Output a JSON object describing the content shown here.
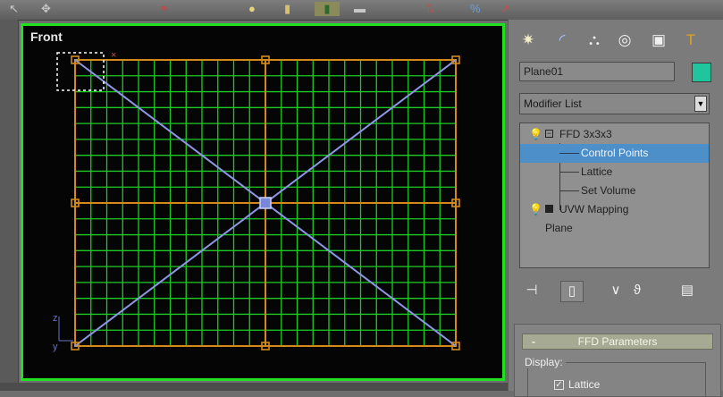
{
  "viewport": {
    "label": "Front",
    "colors": {
      "border": "#20e020",
      "grid": "#1ecb24",
      "lattice": "#d48a1a",
      "diagonal": "#8d97e6",
      "selection": "#ffffff"
    }
  },
  "toolbar": {
    "icons": [
      "select-icon",
      "move-icon",
      "link-icon",
      "light-icon",
      "pan-icon",
      "snap-icon",
      "angle-snap-icon",
      "mirror-icon",
      "align-icon",
      "curve-editor-icon"
    ]
  },
  "command_panel": {
    "tabs": [
      "create-tab",
      "modify-tab",
      "hierarchy-tab",
      "motion-tab",
      "display-tab",
      "utilities-tab"
    ],
    "object_name": "Plane01",
    "object_color": "#1fc59c",
    "modifier_list_label": "Modifier List",
    "stack": [
      {
        "label": "FFD 3x3x3",
        "type": "modifier"
      },
      {
        "label": "Control Points",
        "type": "sub"
      },
      {
        "label": "Lattice",
        "type": "sub"
      },
      {
        "label": "Set Volume",
        "type": "sub"
      },
      {
        "label": "UVW Mapping",
        "type": "modifier"
      },
      {
        "label": "Plane",
        "type": "base"
      }
    ],
    "rollout": {
      "collapse_symbol": "-",
      "title": "FFD Parameters",
      "display_group": "Display:",
      "lattice_label": "Lattice",
      "lattice_checked": true
    }
  }
}
